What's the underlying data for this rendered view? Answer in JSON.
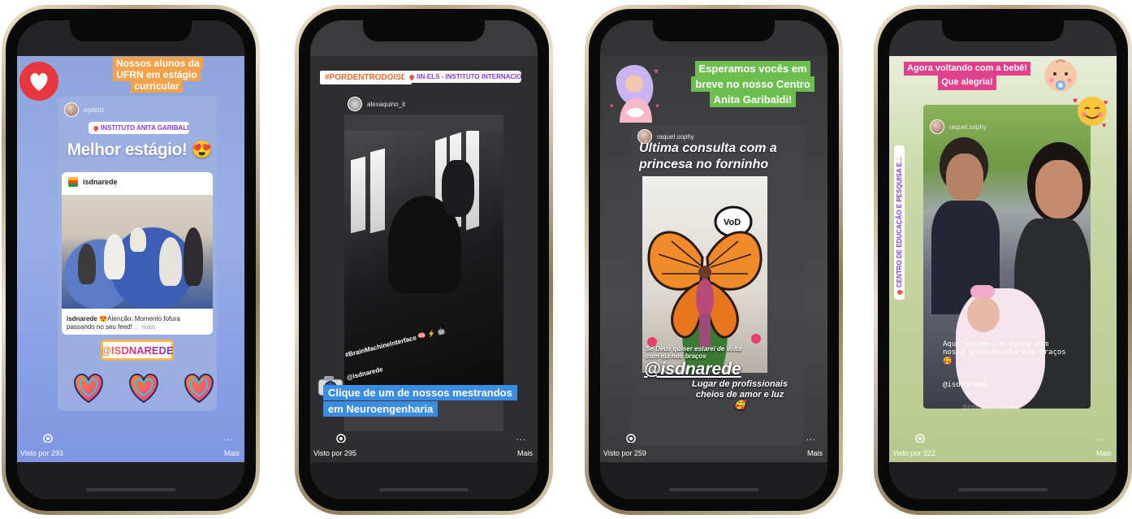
{
  "phones": [
    {
      "user": "npdiniz",
      "caption": "Nossos alunos da UFRN em estágio curricular",
      "location": "INSTITUTO ANITA GARIBALDI",
      "headline": "Melhor estágio! 😍",
      "post_account": "isdnarede",
      "post_caption_user": "isdnarede",
      "post_caption": "😍Atenção: Momento fofura passando no seu feed!",
      "post_more": "... mais",
      "mention": "@ISDNAREDE",
      "views": "Visto por 293",
      "more": "Mais",
      "dots": "..."
    },
    {
      "hashtag": "#PORDENTRODOISD",
      "location": "IIN-ELS - INSTITUTO INTERNACIONAL...",
      "user": "alexaquino_it",
      "photo_tag": "#BrainMachineInterface 🧠 ⚡ 🤖",
      "photo_mention": "@isdnarede",
      "caption": "Clique de um de nossos mestrandos em Neuroengenharia",
      "views": "Visto por 295",
      "more": "Mais",
      "dots": "..."
    },
    {
      "caption": "Esperamos vocês em breve no nosso Centro Anita Garibaldi!",
      "user": "raquel.sophy",
      "headline": "Última consulta com a princesa no forninho",
      "sub_caption": "Se Deus quiser estarei de volta com ela nos braços",
      "mention": "@isdnarede",
      "tagline": "Lugar de profissionais cheios de amor e luz 🥰",
      "views": "Visto por 259",
      "more": "Mais",
      "dots": "..."
    },
    {
      "caption_line1": "Agora voltando com a bebê!",
      "caption_line2": "Que alegria!",
      "location": "CENTRO DE EDUCAÇÃO E PESQUISA E...",
      "user": "raquel.sophy",
      "overlay_text": "Aqui estamos e agora com nossa princesinha nos braços 🥰",
      "overlay_mention": "@isdnarede",
      "overlay_mention2": "@ronivoncunha",
      "views": "Visto por 322",
      "more": "Mais",
      "dots": "..."
    }
  ]
}
